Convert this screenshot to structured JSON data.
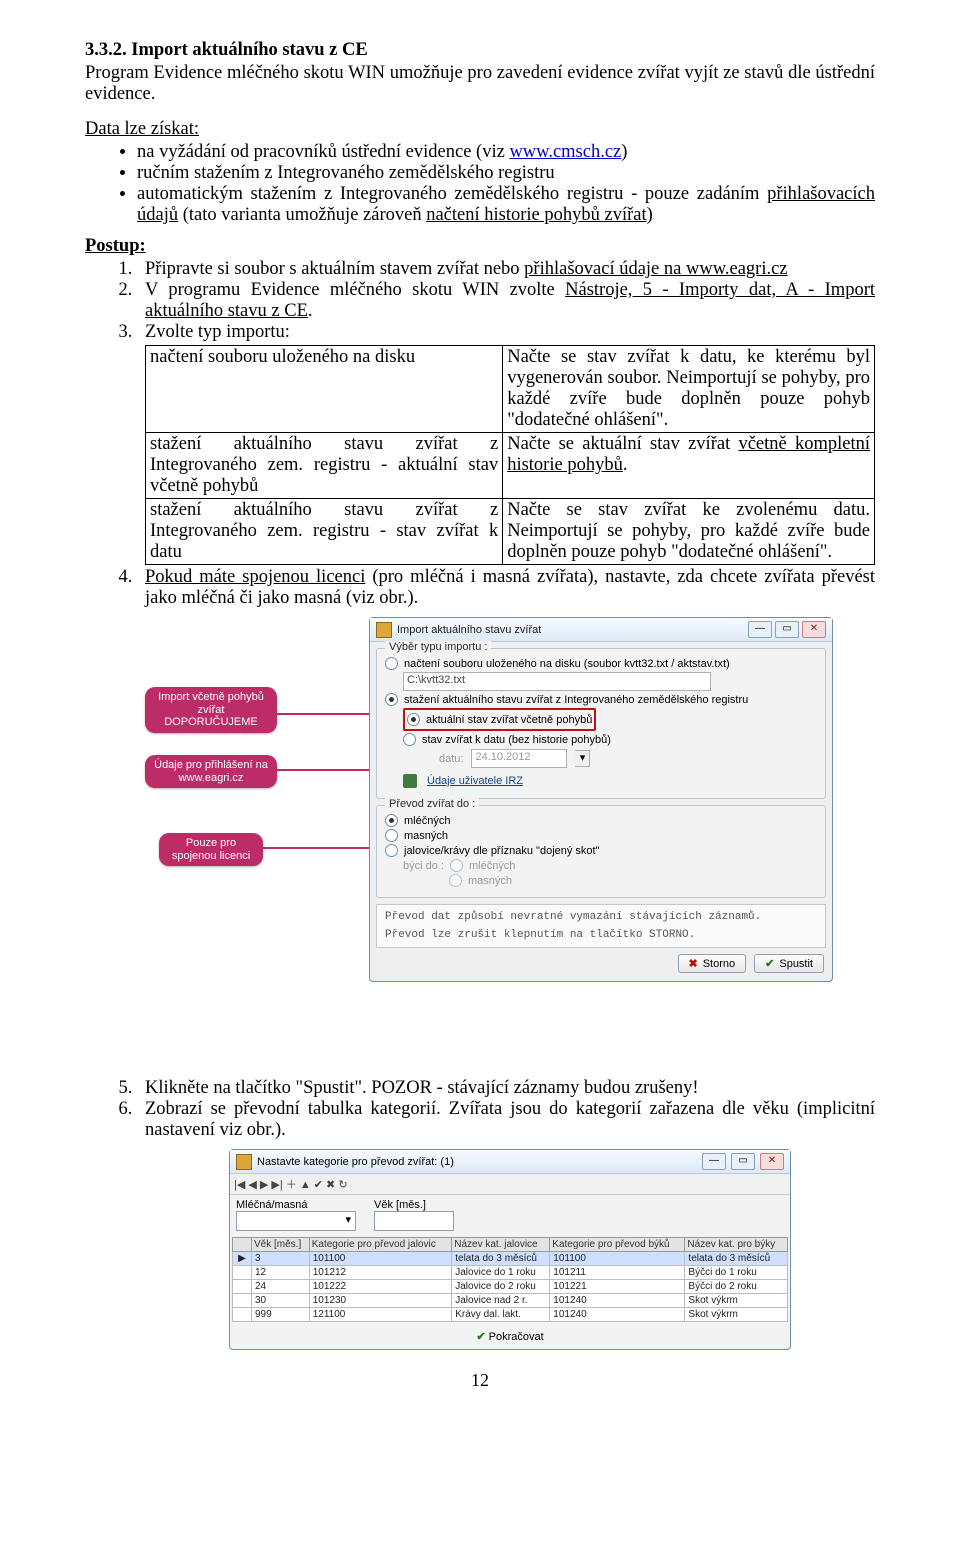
{
  "section": {
    "title": "3.3.2. Import aktuálního stavu z CE",
    "intro": "Program Evidence mléčného skotu WIN umožňuje pro zavedení evidence zvířat vyjít ze stavů dle ústřední evidence.",
    "data_lead": "Data lze získat:",
    "bullets": {
      "b1_pre": "na vyžádání od pracovníků ústřední evidence (viz ",
      "b1_link": "www.cmsch.cz",
      "b1_post": ")",
      "b2": "ručním stažením z Integrovaného zemědělského registru",
      "b3_pre": "automatickým stažením z Integrovaného zemědělského registru - pouze zadáním ",
      "b3_u1": "přihlašovacích údajů",
      "b3_mid": " (tato varianta umožňuje zároveň ",
      "b3_u2": "načtení historie pohybů zvířat",
      "b3_post": ")"
    },
    "postup_label": "Postup:",
    "steps": {
      "s1_pre": "Připravte si soubor s aktuálním stavem zvířat nebo ",
      "s1_u": "přihlašovací údaje na www.eagri.cz",
      "s2_pre": "V programu Evidence mléčného skotu WIN zvolte ",
      "s2_u": "Nástroje, 5 - Importy dat, A - Import aktuálního stavu z CE",
      "s2_post": ".",
      "s3": "Zvolte typ importu:",
      "s4_pre": "",
      "s4_u": "Pokud máte spojenou licenci",
      "s4_post": " (pro mléčná i masná zvířata), nastavte, zda chcete zvířata převést jako mléčná či jako masná (viz obr.).",
      "s5": "Klikněte na tlačítko \"Spustit\". POZOR - stávající záznamy budou zrušeny!",
      "s6": "Zobrazí se převodní tabulka kategorií. Zvířata jsou do kategorií zařazena dle věku (implicitní nastavení viz obr.)."
    },
    "table": {
      "r1c1": "načtení souboru uloženého na disku",
      "r1c2": "Načte se stav zvířat k datu, ke kterému byl vygenerován soubor. Neimportují se pohyby, pro každé zvíře bude doplněn pouze pohyb \"dodatečné ohlášení\".",
      "r2c1": "stažení aktuálního stavu zvířat z Integrovaného zem. registru - aktuální stav včetně pohybů",
      "r2c2_pre": "Načte se aktuální stav zvířat ",
      "r2c2_u": "včetně kompletní historie pohybů",
      "r2c2_post": ".",
      "r3c1": "stažení aktuálního stavu zvířat z Integrovaného zem. registru - stav zvířat k datu",
      "r3c2": "Načte se stav zvířat ke zvolenému datu. Neimportují se pohyby, pro každé zvíře bude doplněn pouze pohyb \"dodatečné ohlášení\"."
    }
  },
  "callouts": {
    "c1": "Import včetně pohybů zvířat DOPORUČUJEME",
    "c2": "Údaje pro přihlášení na www.eagri.cz",
    "c3": "Pouze pro spojenou licenci"
  },
  "dialog1": {
    "title": "Import aktuálního stavu zvířat",
    "fs1_legend": "Výběr typu importu :",
    "r_file": "načtení souboru uloženého na disku (soubor kvtt32.txt / aktstav.txt)",
    "path": "C:\\kvtt32.txt",
    "r_izr": "stažení aktuálního stavu zvířat z Integrovaného zemědělského registru",
    "r_izr_actual": "aktuální stav zvířat včetně pohybů",
    "r_izr_kdatu": "stav zvířat k datu (bez historie pohybů)",
    "datu_label": "datu:",
    "datu_val": "24.10.2012",
    "irz": "Údaje uživatele IRZ",
    "fs2_legend": "Převod zvířat do :",
    "r_mlec": "mléčných",
    "r_masn": "masných",
    "r_jal": "jalovice/krávy dle příznaku \"dojený skot\"",
    "byci_label": "býci do :",
    "r_byci_m": "mléčných",
    "r_byci_n": "masných",
    "msg1": "Převod dat způsobí nevratné vymazání stávajících záznamů.",
    "msg2": "Převod lze zrušit klepnutím na tlačítko STORNO.",
    "storno": "Storno",
    "spustit": "Spustit"
  },
  "dialog2": {
    "title": "Nastavte kategorie pro převod zvířat: (1)",
    "lbl1": "Mléčná/masná",
    "lbl2": "Věk [měs.]",
    "headers": [
      "Věk [měs.]",
      "Kategorie pro převod jalovic",
      "Název kat. jalovice",
      "Kategorie pro převod býků",
      "Název kat. pro býky"
    ],
    "rows": [
      [
        "3",
        "101100",
        "telata do 3 měsíců",
        "101100",
        "telata do 3 měsíců"
      ],
      [
        "12",
        "101212",
        "Jalovice do 1 roku",
        "101211",
        "Býčci do 1 roku"
      ],
      [
        "24",
        "101222",
        "Jalovice do 2 roku",
        "101221",
        "Býčci do 2 roku"
      ],
      [
        "30",
        "101230",
        "Jalovice nad 2 r.",
        "101240",
        "Skot výkrm"
      ],
      [
        "999",
        "121100",
        "Krávy dal. lakt.",
        "101240",
        "Skot výkrm"
      ]
    ],
    "pokr": "Pokračovat"
  },
  "page_number": "12"
}
